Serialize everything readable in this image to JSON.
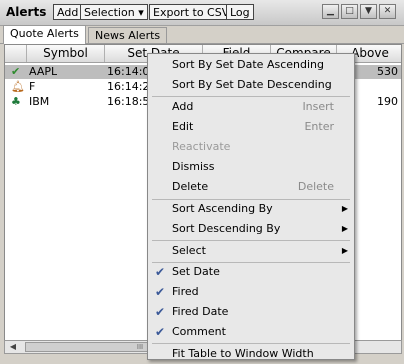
{
  "window": {
    "title": "Alerts"
  },
  "toolbar": {
    "add": "Add",
    "selection": "Selection ▾",
    "export": "Export to CSV",
    "log": "Log"
  },
  "tabs": [
    {
      "label": "Quote Alerts",
      "active": true
    },
    {
      "label": "News Alerts",
      "active": false
    }
  ],
  "table": {
    "columns": [
      "Symbol",
      "Set Date",
      "Field",
      "Compare",
      "Above"
    ],
    "rows": [
      {
        "icon": "checkmark-icon",
        "symbol": "AAPL",
        "set_date": "16:14:0",
        "above": "530",
        "selected": true
      },
      {
        "icon": "bell-icon",
        "symbol": "F",
        "set_date": "16:14:2",
        "above": ""
      },
      {
        "icon": "tree-icon",
        "symbol": "IBM",
        "set_date": "16:18:5",
        "above": "190"
      }
    ]
  },
  "scrollbar": {
    "thumb_grip": "III"
  },
  "context_menu": {
    "items": [
      {
        "label": "Sort By Set Date Ascending"
      },
      {
        "label": "Sort By Set Date Descending"
      },
      {
        "label": "Add",
        "shortcut": "Insert"
      },
      {
        "label": "Edit",
        "shortcut": "Enter"
      },
      {
        "label": "Reactivate",
        "disabled": true
      },
      {
        "label": "Dismiss"
      },
      {
        "label": "Delete",
        "shortcut": "Delete"
      },
      {
        "label": "Sort Ascending By",
        "submenu": true
      },
      {
        "label": "Sort Descending By",
        "submenu": true
      },
      {
        "label": "Select",
        "submenu": true
      },
      {
        "label": "Set Date",
        "checked": true
      },
      {
        "label": "Fired",
        "checked": true
      },
      {
        "label": "Fired Date",
        "checked": true
      },
      {
        "label": "Comment",
        "checked": true
      },
      {
        "label": "Fit Table to Window Width"
      }
    ]
  }
}
